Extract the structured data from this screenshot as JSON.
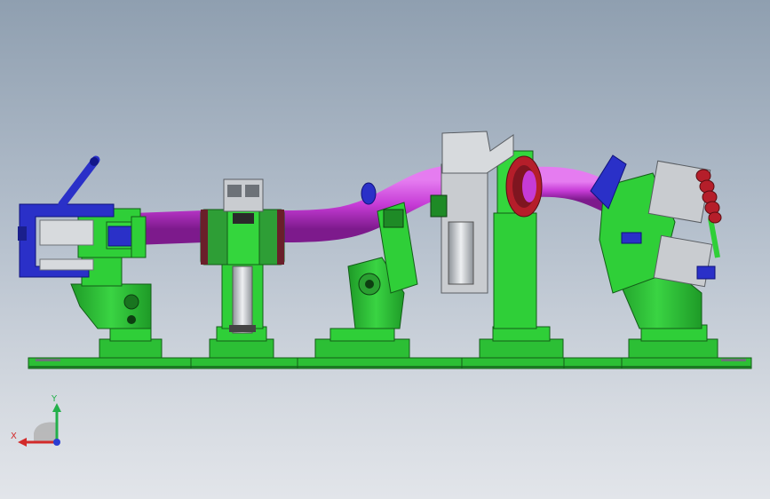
{
  "viewport": {
    "description_visible": false
  },
  "triad": {
    "x_label": "X",
    "y_label": "Y",
    "colors": {
      "x": "#d22a2a",
      "y": "#23b04a",
      "z": "#2a3dd2",
      "cone": "#b5b5b5"
    }
  },
  "colors": {
    "fixture_green": "#2fcf38",
    "fixture_green_dark": "#17861f",
    "clamp_blue": "#2a30c8",
    "tube_magenta": "#c63bd6",
    "tube_magenta_dark": "#8d1d9c",
    "gear_red": "#b51e2a",
    "metal_grey": "#c9ccd0",
    "metal_dark": "#6d7278",
    "base_green": "#34c43c"
  }
}
